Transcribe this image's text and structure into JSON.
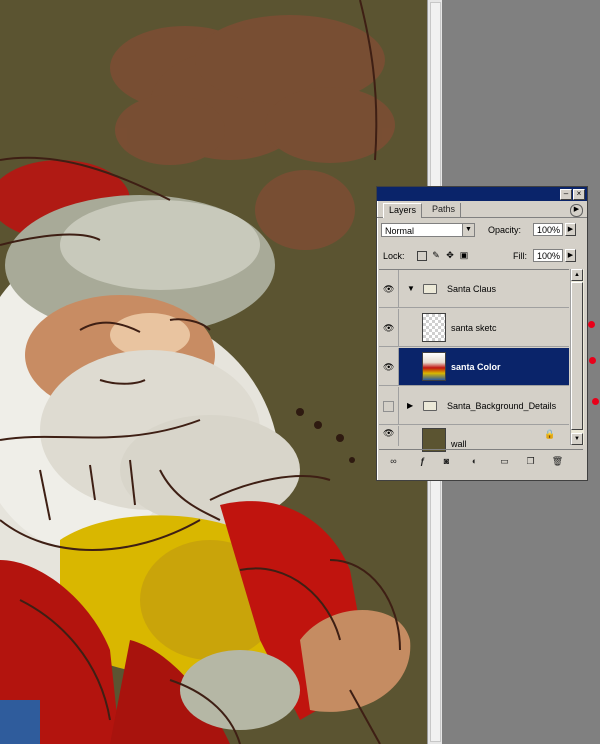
{
  "layers_panel": {
    "tabs": [
      {
        "label": "Layers",
        "active": true
      },
      {
        "label": "Paths",
        "active": false
      }
    ],
    "blend_mode": "Normal",
    "opacity_label": "Opacity:",
    "opacity_value": "100%",
    "lock_label": "Lock:",
    "fill_label": "Fill:",
    "fill_value": "100%",
    "layers": [
      {
        "name": "Santa Claus",
        "type": "group",
        "visible": true,
        "expanded": true
      },
      {
        "name": "santa sketc",
        "type": "layer",
        "visible": true
      },
      {
        "name": "santa Color",
        "type": "layer",
        "visible": true,
        "selected": true
      },
      {
        "name": "Santa_Background_Details",
        "type": "group",
        "visible": false,
        "expanded": false
      },
      {
        "name": "wall",
        "type": "layer",
        "visible": true,
        "locked": true
      }
    ]
  },
  "colors": {
    "canvas_background": "#5b5431",
    "selection_highlight": "#0a246a",
    "annotation_dot": "#e8001a"
  }
}
